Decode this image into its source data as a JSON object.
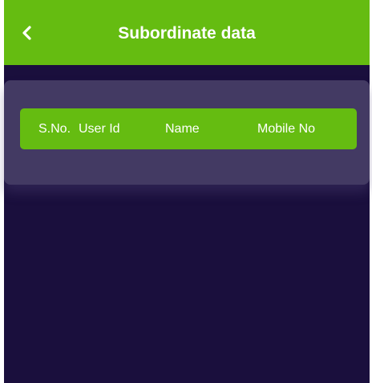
{
  "header": {
    "title": "Subordinate data",
    "back_icon": "chevron-left-icon"
  },
  "table": {
    "columns": [
      "S.No.",
      "User Id",
      "Name",
      "Mobile No"
    ],
    "rows": []
  },
  "colors": {
    "accent": "#65bc11",
    "background": "#1a0f3d",
    "card": "#433a63",
    "text": "#ffffff"
  }
}
